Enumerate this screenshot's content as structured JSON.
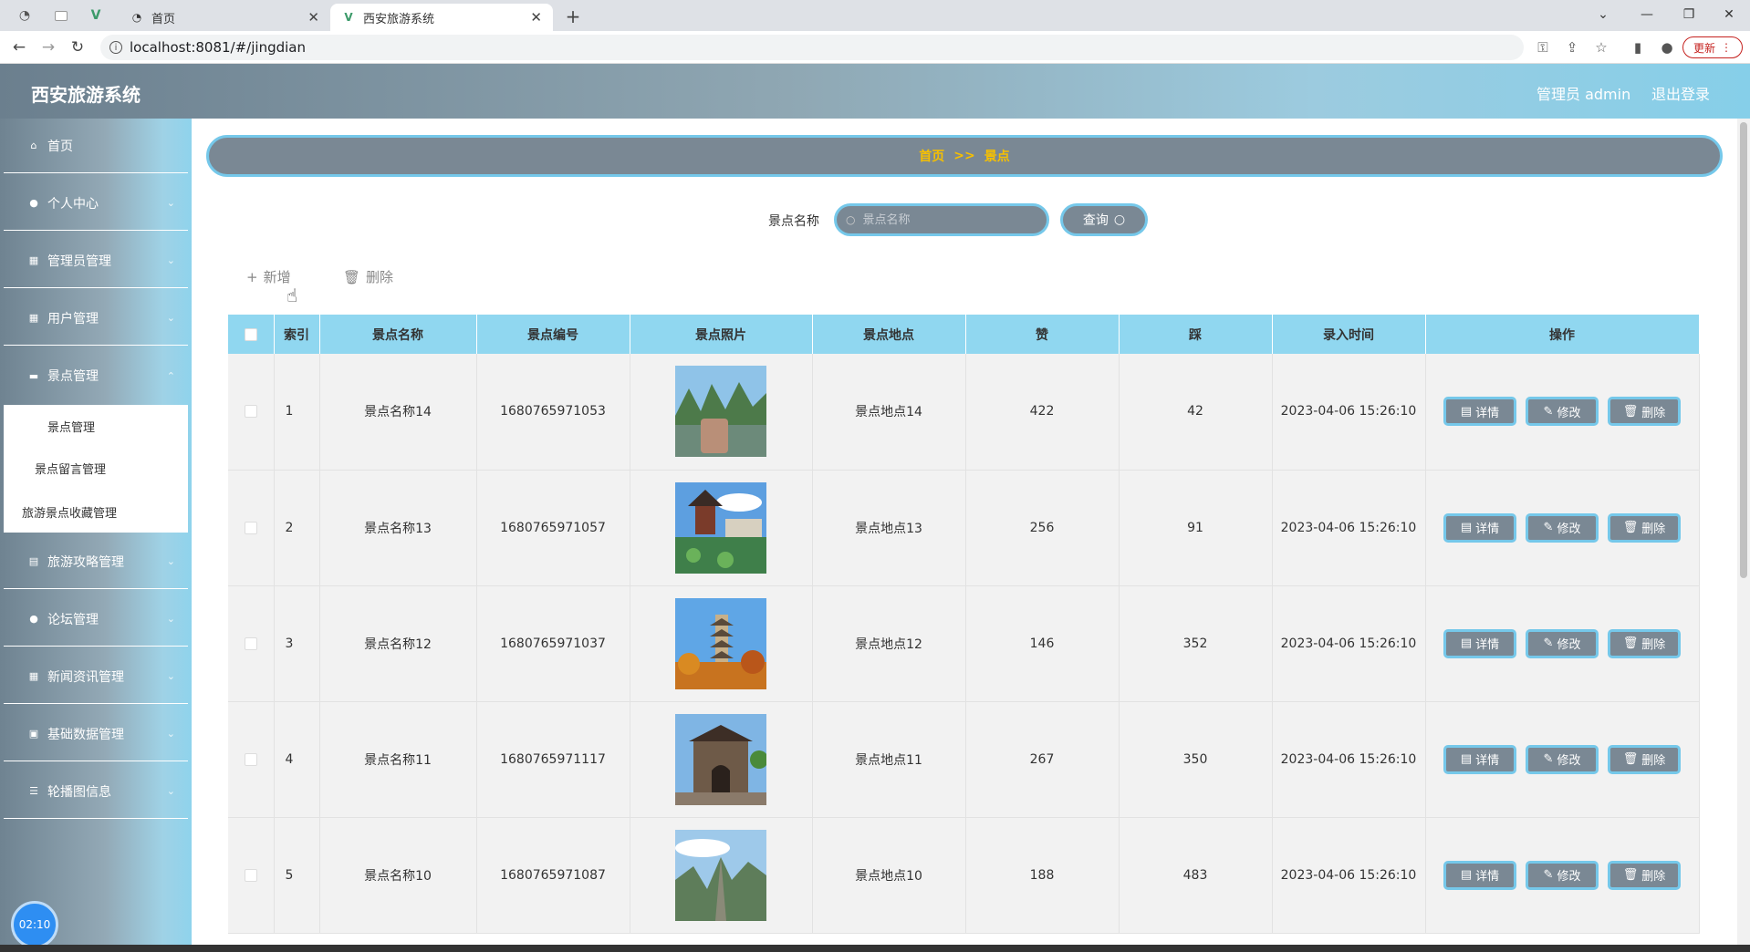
{
  "browser": {
    "tabs": [
      {
        "title": "首页",
        "active": false
      },
      {
        "title": "西安旅游系统",
        "active": true
      }
    ],
    "url": "localhost:8081/#/jingdian",
    "update_label": "更新"
  },
  "header": {
    "app_title": "西安旅游系统",
    "admin_label": "管理员 admin",
    "logout_label": "退出登录"
  },
  "sidebar": {
    "items": [
      {
        "label": "首页",
        "icon": "home-icon",
        "has_children": false
      },
      {
        "label": "个人中心",
        "icon": "user-icon",
        "has_children": true
      },
      {
        "label": "管理员管理",
        "icon": "grid-icon",
        "has_children": true
      },
      {
        "label": "用户管理",
        "icon": "grid-icon",
        "has_children": true
      },
      {
        "label": "景点管理",
        "icon": "chat-icon",
        "has_children": true,
        "expanded": true
      },
      {
        "label": "旅游攻略管理",
        "icon": "document-icon",
        "has_children": true
      },
      {
        "label": "论坛管理",
        "icon": "user-icon",
        "has_children": true
      },
      {
        "label": "新闻资讯管理",
        "icon": "grid-icon",
        "has_children": true
      },
      {
        "label": "基础数据管理",
        "icon": "briefcase-icon",
        "has_children": true
      },
      {
        "label": "轮播图信息",
        "icon": "list-icon",
        "has_children": true
      }
    ],
    "submenu": [
      "景点管理",
      "景点留言管理",
      "旅游景点收藏管理"
    ],
    "clock": "02:10"
  },
  "breadcrumb": {
    "home": "首页",
    "separator": ">>",
    "current": "景点"
  },
  "search": {
    "label": "景点名称",
    "placeholder": "景点名称",
    "button": "查询"
  },
  "actions": {
    "add": "新增",
    "delete": "删除"
  },
  "table": {
    "headers": [
      "索引",
      "景点名称",
      "景点编号",
      "景点照片",
      "景点地点",
      "赞",
      "踩",
      "录入时间",
      "操作"
    ],
    "rows": [
      {
        "index": "1",
        "name": "景点名称14",
        "code": "1680765971053",
        "location": "景点地点14",
        "likes": "422",
        "dislikes": "42",
        "time": "2023-04-06 15:26:10",
        "photo": "karst-river"
      },
      {
        "index": "2",
        "name": "景点名称13",
        "code": "1680765971057",
        "location": "景点地点13",
        "likes": "256",
        "dislikes": "91",
        "time": "2023-04-06 15:26:10",
        "photo": "pavilion-lake"
      },
      {
        "index": "3",
        "name": "景点名称12",
        "code": "1680765971037",
        "location": "景点地点12",
        "likes": "146",
        "dislikes": "352",
        "time": "2023-04-06 15:26:10",
        "photo": "pagoda-autumn"
      },
      {
        "index": "4",
        "name": "景点名称11",
        "code": "1680765971117",
        "location": "景点地点11",
        "likes": "267",
        "dislikes": "350",
        "time": "2023-04-06 15:26:10",
        "photo": "city-gate"
      },
      {
        "index": "5",
        "name": "景点名称10",
        "code": "1680765971087",
        "location": "景点地点10",
        "likes": "188",
        "dislikes": "483",
        "time": "2023-04-06 15:26:10",
        "photo": "mountain-cliff"
      }
    ],
    "ops": {
      "detail": "详情",
      "edit": "修改",
      "delete": "删除"
    }
  },
  "colors": {
    "accent": "#75c8ea",
    "button_bg": "#7a8894",
    "breadcrumb_text": "#f6c000",
    "header_row": "#90d7f0"
  }
}
